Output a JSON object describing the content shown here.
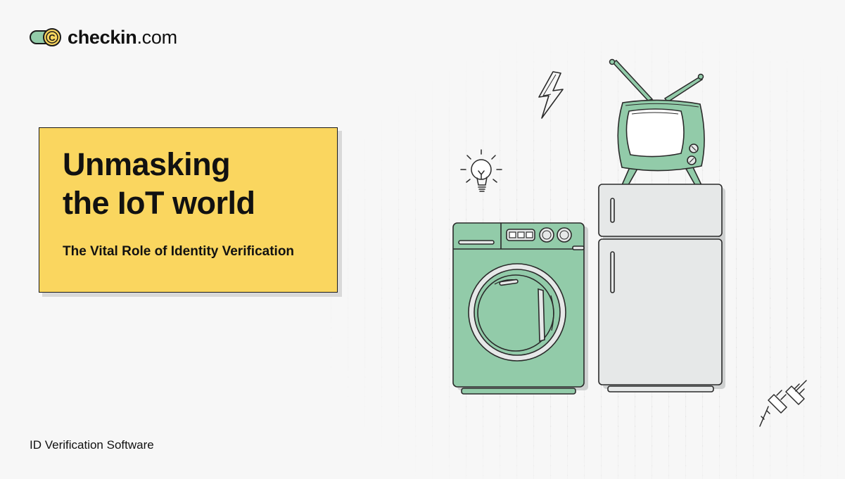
{
  "brand": {
    "logo_icon": "checkin-coin-logo-icon",
    "name_bold": "checkin",
    "name_suffix": ".com"
  },
  "hero": {
    "title_line1": "Unmasking",
    "title_line2": "the IoT world",
    "subtitle": "The Vital Role of Identity Verification",
    "card_color": "#fad65f"
  },
  "footer": {
    "label": "ID Verification Software"
  },
  "illustration": {
    "items": [
      "lightning-icon",
      "lightbulb-icon",
      "tv-illustration",
      "fridge-illustration",
      "washing-machine-illustration",
      "plug-icon"
    ],
    "colors": {
      "appliance_green": "#92cba9",
      "appliance_gray": "#e6e8e8",
      "outline": "#2a2a2a"
    }
  }
}
